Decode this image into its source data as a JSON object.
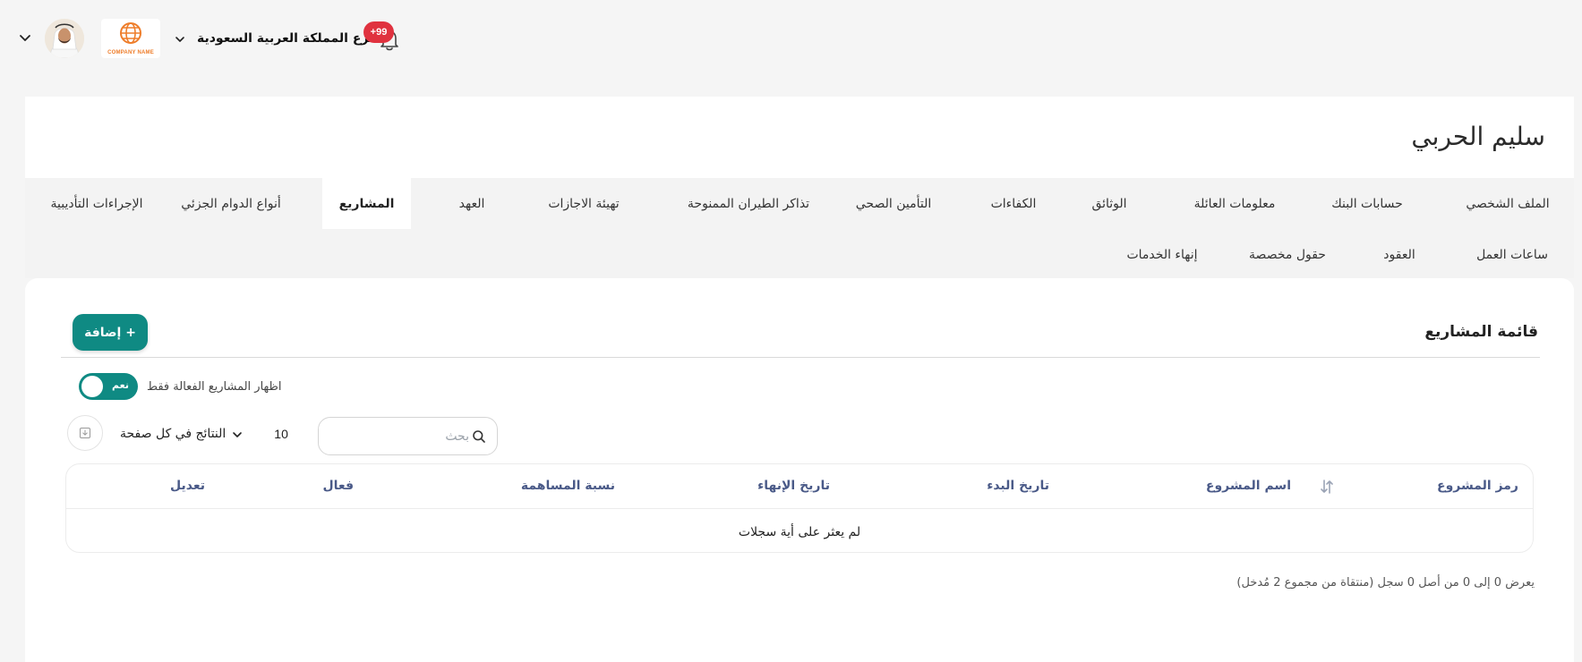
{
  "topbar": {
    "notifications_count": "+99",
    "branch_name": "فرع المملكة العربية السعودية",
    "company_logo_text": "COMPANY NAME",
    "icons": [
      "chevron-down-icon",
      "bell-icon",
      "globe-logo-icon",
      "avatar"
    ]
  },
  "profile": {
    "name": "سليم الحربي"
  },
  "tabs": [
    {
      "label": "الملف الشخصي"
    },
    {
      "label": "حسابات البنك"
    },
    {
      "label": "معلومات العائلة"
    },
    {
      "label": "الوثائق"
    },
    {
      "label": "الكفاءات"
    },
    {
      "label": "التأمين الصحي"
    },
    {
      "label": "تذاكر الطيران الممنوحة"
    },
    {
      "label": "تهيئة الاجازات"
    },
    {
      "label": "العهد"
    },
    {
      "label": "المشاريع"
    },
    {
      "label": "أنواع الدوام الجزئي"
    },
    {
      "label": "الإجراءات التأديبية"
    },
    {
      "label": "ساعات العمل"
    },
    {
      "label": "العقود"
    },
    {
      "label": "حقول مخصصة"
    },
    {
      "label": "إنهاء الخدمات"
    }
  ],
  "active_tab": "المشاريع",
  "projects": {
    "title": "قائمة المشاريع",
    "add_label": "+ إضافة",
    "active_only_label": "اظهار المشاريع الفعالة فقط",
    "toggle_text": "نعم",
    "search_placeholder": "بحث",
    "page_size_label": "النتائج في كل صفحة",
    "page_size_value": "10",
    "columns": [
      "رمز المشروع",
      "اسم المشروع",
      "تاريخ البدء",
      "تاريخ الإنهاء",
      "نسبة المساهمة",
      "فعال",
      "تعديل"
    ],
    "empty_text": "لم يعثر على أية سجلات",
    "info_text": "يعرض 0 إلى 0 من أصل 0 سجل (منتقاة من مجموع 2 مُدخل)"
  },
  "colors": {
    "accent": "#0f8a83",
    "badge": "#e0323f",
    "header_text": "#4a5a88",
    "logo_orange": "#ee7d2a"
  }
}
